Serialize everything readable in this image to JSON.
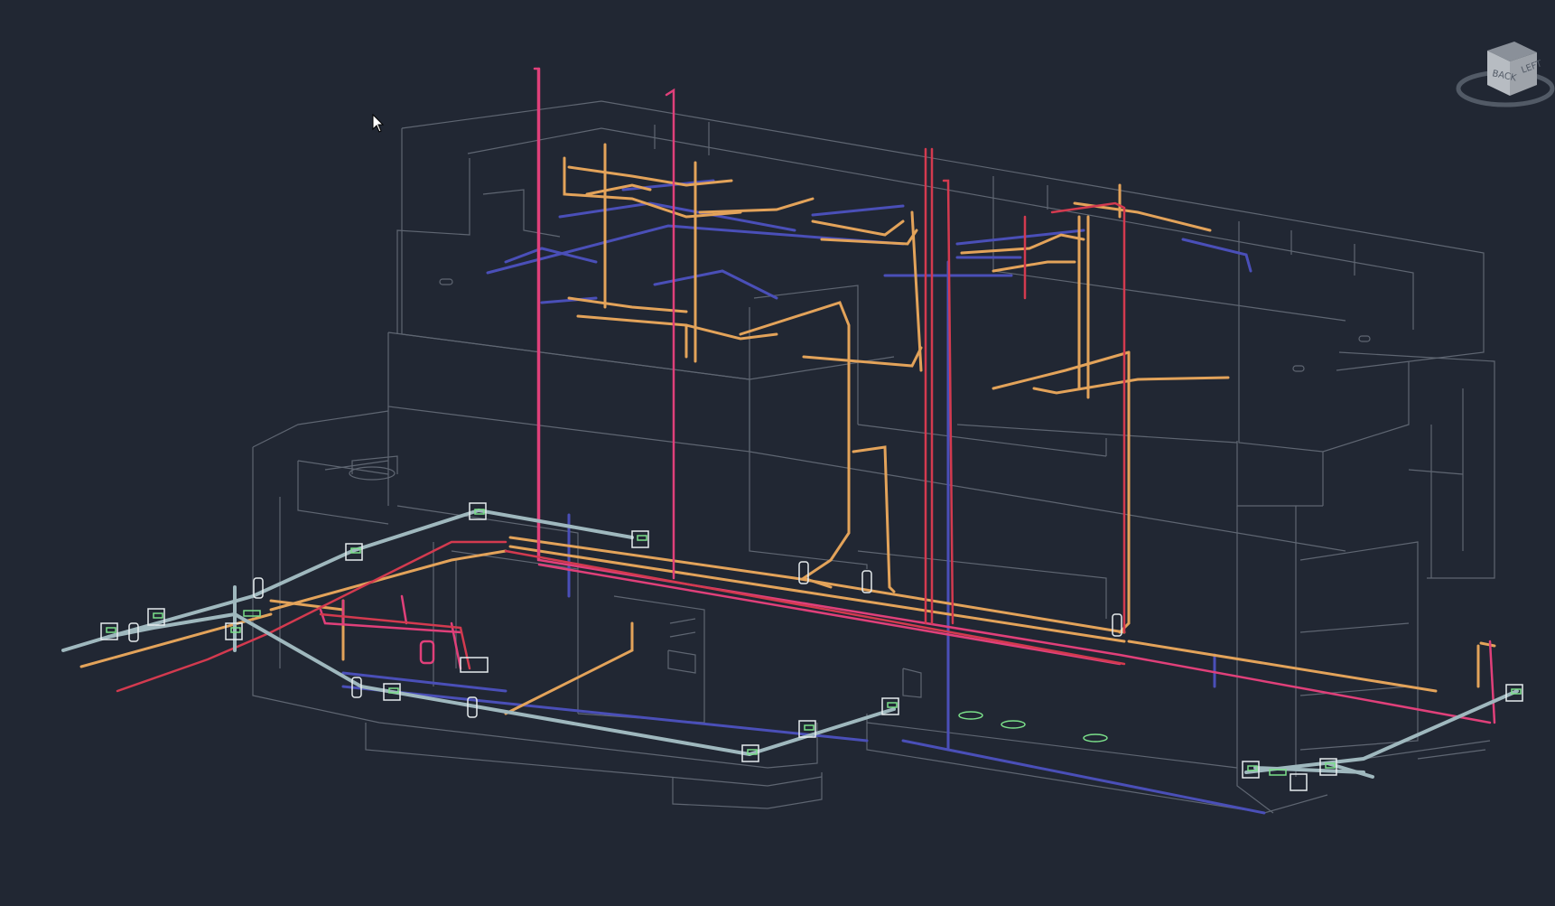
{
  "app": {
    "background_color": "#212733"
  },
  "viewcube": {
    "face_back": "BACK",
    "face_left": "LEFT",
    "icon": "viewcube-icon"
  },
  "colors": {
    "building_edges": "#5f6672",
    "hot_water": "#e3a35a",
    "cold_water": "#4a4fb8",
    "fire_riser": "#e0407a",
    "gas_line": "#d33a4f",
    "sewer": "#9fb8be",
    "fitting": "#7be08a"
  },
  "cursor": {
    "icon": "mouse-pointer-icon"
  }
}
